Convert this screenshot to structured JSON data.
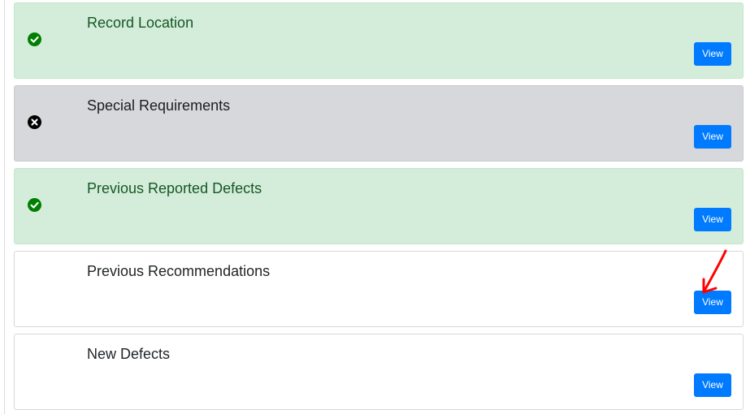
{
  "sections": [
    {
      "title": "Record Location",
      "status": "complete",
      "status_icon": "check-circle-icon",
      "button_label": "View",
      "bg": "#d4edda"
    },
    {
      "title": "Special Requirements",
      "status": "failed",
      "status_icon": "x-circle-icon",
      "button_label": "View",
      "bg": "#d6d8db"
    },
    {
      "title": "Previous Reported Defects",
      "status": "complete",
      "status_icon": "check-circle-icon",
      "button_label": "View",
      "bg": "#d4edda"
    },
    {
      "title": "Previous Recommendations",
      "status": "none",
      "status_icon": "",
      "button_label": "View",
      "bg": "#ffffff"
    },
    {
      "title": "New Defects",
      "status": "none",
      "status_icon": "",
      "button_label": "View",
      "bg": "#ffffff"
    }
  ],
  "colors": {
    "accent": "#007bff",
    "success": "#008000",
    "annotation": "#ff0000"
  },
  "annotation": {
    "type": "arrow",
    "target": "Previous Recommendations View button",
    "icon": "red-arrow-icon"
  }
}
